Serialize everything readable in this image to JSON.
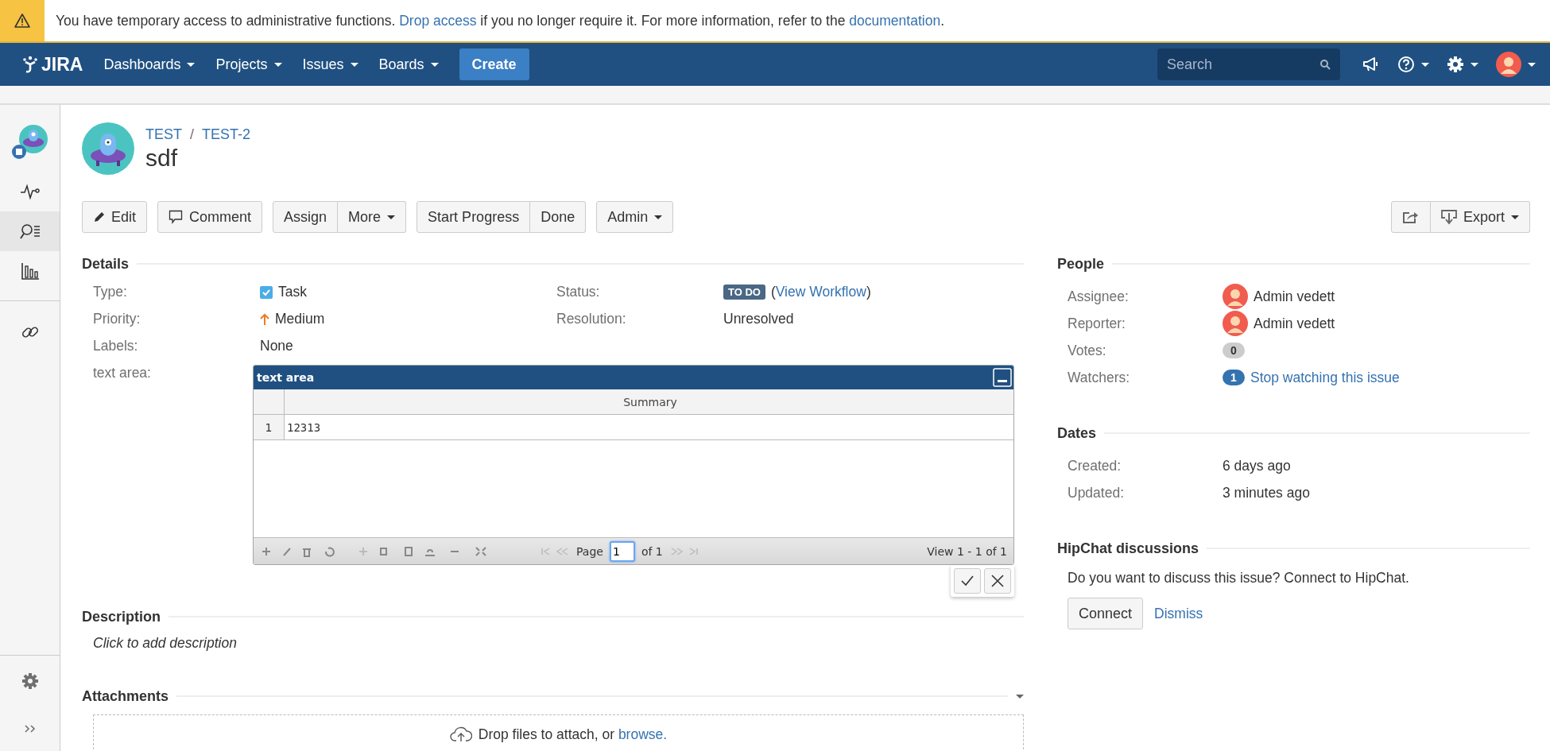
{
  "banner": {
    "segments": [
      {
        "kind": "text",
        "text": "You have temporary access to administrative functions. "
      },
      {
        "kind": "link",
        "text": "Drop access"
      },
      {
        "kind": "text",
        "text": " if you no longer require it. For more information, refer to the "
      },
      {
        "kind": "link",
        "text": "documentation"
      },
      {
        "kind": "text",
        "text": "."
      }
    ]
  },
  "nav": {
    "logo": "JIRA",
    "menus": [
      {
        "label": "Dashboards"
      },
      {
        "label": "Projects"
      },
      {
        "label": "Issues"
      },
      {
        "label": "Boards"
      }
    ],
    "create": "Create",
    "search": {
      "placeholder": "Search"
    }
  },
  "sidebar": {
    "items": [
      {
        "kind": "project",
        "selected": false
      },
      {
        "kind": "activity",
        "selected": false
      },
      {
        "kind": "issues",
        "selected": true
      },
      {
        "kind": "reports",
        "selected": false
      },
      {
        "kind": "link",
        "selected": false
      }
    ]
  },
  "issue": {
    "breadcrumbs": [
      "TEST",
      "TEST-2"
    ],
    "separator": "/",
    "title": "sdf"
  },
  "toolbar": {
    "groups": [
      [
        {
          "label": "Edit",
          "kind": "edit",
          "dropdown": false
        }
      ],
      [
        {
          "label": "Comment",
          "kind": "comment",
          "dropdown": false
        }
      ],
      [
        {
          "label": "Assign",
          "kind": "plain",
          "dropdown": false
        },
        {
          "label": "More",
          "kind": "plain",
          "dropdown": true
        }
      ],
      [
        {
          "label": "Start Progress",
          "kind": "plain",
          "dropdown": false
        },
        {
          "label": "Done",
          "kind": "plain",
          "dropdown": false
        }
      ],
      [
        {
          "label": "Admin",
          "kind": "plain",
          "dropdown": true
        }
      ]
    ],
    "right": [
      {
        "kind": "share",
        "dropdown": false
      },
      {
        "label": "Export",
        "kind": "export",
        "dropdown": true
      }
    ]
  },
  "details": {
    "heading": "Details",
    "fields": [
      {
        "label": "Type:",
        "kind": "type",
        "value": "Task"
      },
      {
        "label": "Status:",
        "kind": "status",
        "badge": "TO DO",
        "before": "(",
        "link": "View Workflow",
        "after": ")"
      },
      {
        "label": "Priority:",
        "kind": "priority",
        "value": "Medium"
      },
      {
        "label": "Resolution:",
        "kind": "plain",
        "value": "Unresolved"
      },
      {
        "label": "Labels:",
        "kind": "plain",
        "value": "None"
      }
    ],
    "text_area": {
      "label": "text area:",
      "title": "text area",
      "columns": [
        "Summary"
      ],
      "rows": [
        {
          "num": "1",
          "cells": [
            "12313"
          ]
        }
      ],
      "pager": {
        "page_label": "Page",
        "page": "1",
        "of": "of 1",
        "view": "View 1 - 1 of 1"
      }
    }
  },
  "description": {
    "heading": "Description",
    "placeholder": "Click to add description"
  },
  "attachments": {
    "heading": "Attachments",
    "drop_text": "Drop files to attach, or ",
    "browse": "browse."
  },
  "people": {
    "heading": "People",
    "rows": [
      {
        "label": "Assignee:",
        "kind": "user",
        "value": "Admin vedett"
      },
      {
        "label": "Reporter:",
        "kind": "user",
        "value": "Admin vedett"
      },
      {
        "label": "Votes:",
        "kind": "count",
        "count": "0"
      },
      {
        "label": "Watchers:",
        "kind": "watch",
        "count": "1",
        "link": "Stop watching this issue"
      }
    ]
  },
  "dates": {
    "heading": "Dates",
    "rows": [
      {
        "label": "Created:",
        "value": "6 days ago"
      },
      {
        "label": "Updated:",
        "value": "3 minutes ago"
      }
    ]
  },
  "hipchat": {
    "heading": "HipChat discussions",
    "text": "Do you want to discuss this issue? Connect to HipChat.",
    "connect": "Connect",
    "dismiss": "Dismiss"
  }
}
